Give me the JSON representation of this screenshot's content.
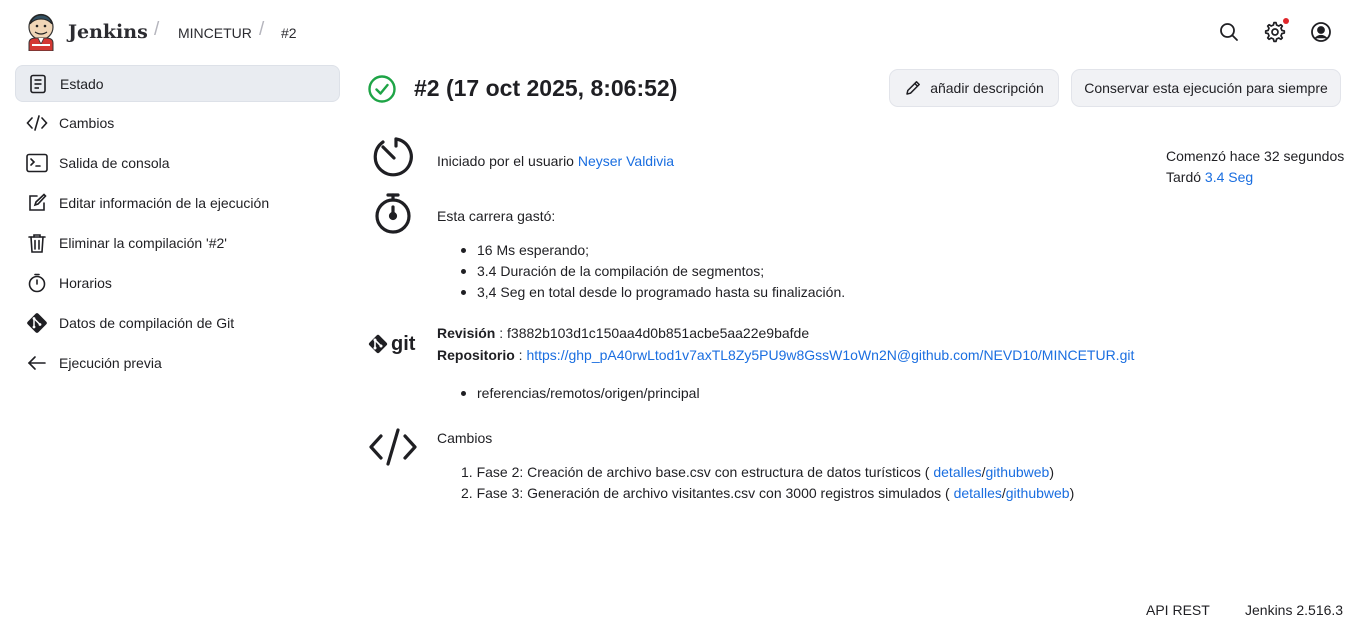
{
  "header": {
    "brand": "Jenkins",
    "breadcrumbs": [
      "MINCETUR",
      "#2"
    ],
    "icons": [
      "search-icon",
      "settings-icon",
      "user-icon"
    ],
    "notification_color": "#e0262b"
  },
  "sidebar": {
    "items": [
      {
        "label": "Estado",
        "icon": "document-icon",
        "active": true
      },
      {
        "label": "Cambios",
        "icon": "code-icon"
      },
      {
        "label": "Salida de consola",
        "icon": "terminal-icon"
      },
      {
        "label": "Editar información de la ejecución",
        "icon": "edit-icon"
      },
      {
        "label": "Eliminar la compilación '#2'",
        "icon": "trash-icon"
      },
      {
        "label": "Horarios",
        "icon": "stopwatch-icon"
      },
      {
        "label": "Datos de compilación de Git",
        "icon": "git-icon"
      },
      {
        "label": "Ejecución previa",
        "icon": "arrow-left-icon"
      }
    ]
  },
  "build": {
    "title": "#2 (17 oct 2025, 8:06:52)",
    "status_color": "#1ea446",
    "add_description_label": "añadir descripción",
    "keep_forever_label": "Conservar esta ejecución para siempre",
    "started_by_text": "Iniciado por el usuario",
    "started_by_user": "Neyser Valdivia",
    "started_ago": "Comenzó hace 32 segundos",
    "took_label": "Tardó",
    "took_value": "3.4 Seg",
    "timing": {
      "heading": "Esta carrera gastó:",
      "items": [
        "16 Ms esperando;",
        "3.4 Duración de la compilación de segmentos;",
        "3,4 Seg en total desde lo programado hasta su finalización."
      ]
    },
    "git": {
      "logo_text": "git",
      "revision_label": "Revisión",
      "revision": ": f3882b103d1c150aa4d0b851acbe5aa22e9bafde",
      "repo_label": "Repositorio",
      "repo_sep": ":",
      "repo_url": "https://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@github.com/NEVD10/MINCETUR.git",
      "refs": [
        "referencias/remotos/origen/principal"
      ]
    },
    "changes": {
      "heading": "Cambios",
      "items": [
        {
          "num": "1.",
          "text": "Fase 2: Creación de archivo base.csv con estructura de datos turísticos (",
          "details": "detalles",
          "sep": "/",
          "web": "githubweb",
          "close": ")"
        },
        {
          "num": "2.",
          "text": "Fase 3: Generación de archivo visitantes.csv con 3000 registros simulados (",
          "details": "detalles",
          "sep": "/",
          "web": "githubweb",
          "close": ")"
        }
      ]
    }
  },
  "footer": {
    "api": "API REST",
    "version": "Jenkins 2.516.3"
  }
}
